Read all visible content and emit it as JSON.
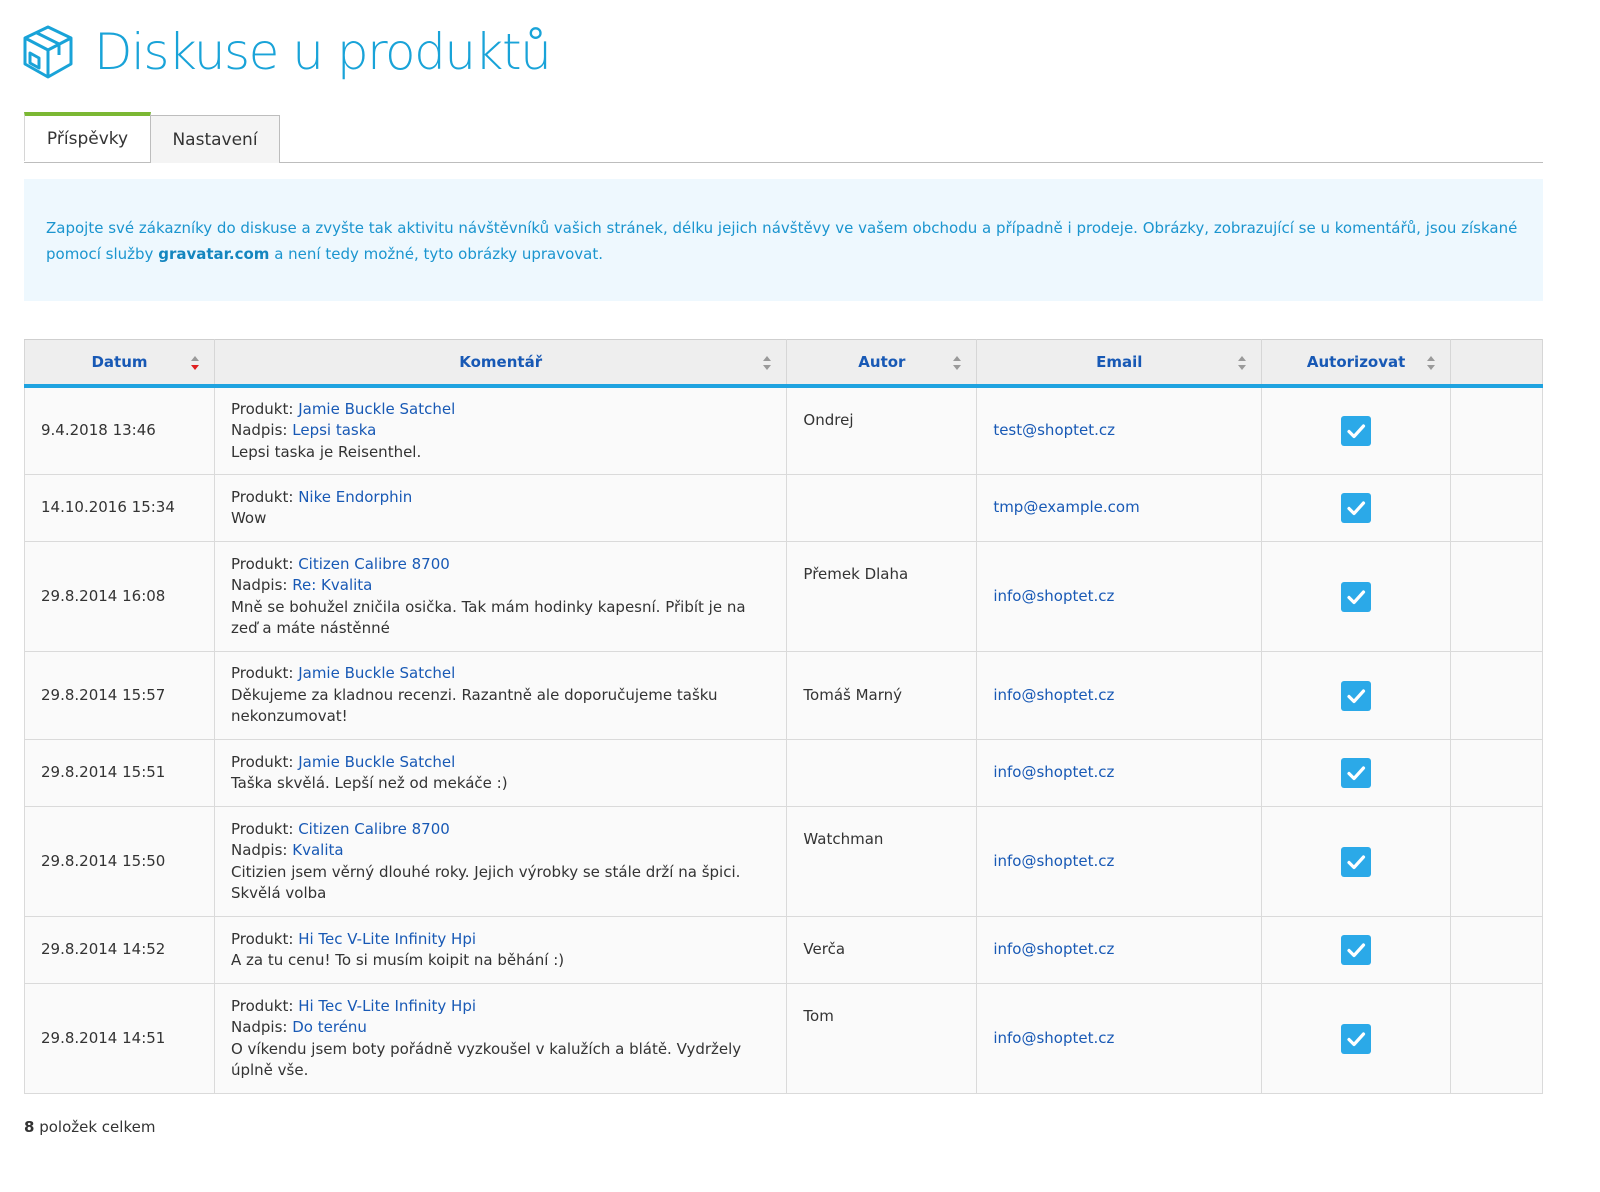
{
  "header": {
    "title": "Diskuse u produktů",
    "icon": "package-box-icon"
  },
  "tabs": [
    {
      "label": "Příspěvky",
      "active": true
    },
    {
      "label": "Nastavení",
      "active": false
    }
  ],
  "info": {
    "text_before": "Zapojte své zákazníky do diskuse a zvyšte tak aktivitu návštěvníků vašich stránek, délku jejich návštěvy ve vašem obchodu a případně i prodeje. Obrázky, zobrazující se u komentářů, jsou získané pomocí služby ",
    "link": "gravatar.com",
    "text_after": " a není tedy možné, tyto obrázky upravovat."
  },
  "table": {
    "columns": [
      "Datum",
      "Komentář",
      "Autor",
      "Email",
      "Autorizovat",
      ""
    ],
    "product_label": "Produkt:",
    "title_label": "Nadpis:",
    "rows": [
      {
        "date": "9.4.2018 13:46",
        "product": "Jamie Buckle Satchel",
        "title": "Lepsi taska",
        "text": "Lepsi taska je Reisenthel.",
        "author": "Ondrej",
        "email": "test@shoptet.cz",
        "authorized": true
      },
      {
        "date": "14.10.2016 15:34",
        "product": "Nike Endorphin",
        "title": "",
        "text": "Wow",
        "author": "",
        "email": "tmp@example.com",
        "authorized": true
      },
      {
        "date": "29.8.2014 16:08",
        "product": "Citizen Calibre 8700",
        "title": "Re: Kvalita",
        "text": "Mně se bohužel zničila osička. Tak mám hodinky kapesní. Přibít je na zeď a máte nástěnné",
        "author": "Přemek Dlaha",
        "email": "info@shoptet.cz",
        "authorized": true
      },
      {
        "date": "29.8.2014 15:57",
        "product": "Jamie Buckle Satchel",
        "title": "",
        "text": "Děkujeme za kladnou recenzi. Razantně ale doporučujeme tašku nekonzumovat!",
        "author": "Tomáš Marný",
        "email": "info@shoptet.cz",
        "authorized": true
      },
      {
        "date": "29.8.2014 15:51",
        "product": "Jamie Buckle Satchel",
        "title": "",
        "text": "Taška skvělá. Lepší než od mekáče :)",
        "author": "",
        "email": "info@shoptet.cz",
        "authorized": true
      },
      {
        "date": "29.8.2014 15:50",
        "product": "Citizen Calibre 8700",
        "title": "Kvalita",
        "text": "Citizien jsem věrný dlouhé roky. Jejich výrobky se stále drží na špici. Skvělá volba",
        "author": "Watchman",
        "email": "info@shoptet.cz",
        "authorized": true
      },
      {
        "date": "29.8.2014 14:52",
        "product": "Hi Tec V-Lite Infinity Hpi",
        "title": "",
        "text": "A za tu cenu! To si musím koipit na běhání :)",
        "author": "Verča",
        "email": "info@shoptet.cz",
        "authorized": true
      },
      {
        "date": "29.8.2014 14:51",
        "product": "Hi Tec V-Lite Infinity Hpi",
        "title": "Do terénu",
        "text": "O víkendu jsem boty pořádně vyzkoušel v kalužích a blátě. Vydržely úplně vše.",
        "author": "Tom",
        "email": "info@shoptet.cz",
        "authorized": true
      }
    ]
  },
  "footer": {
    "count": "8",
    "label": " položek celkem"
  },
  "colors": {
    "accent": "#19a3d8",
    "link": "#1859b5",
    "tab_active": "#7bb833",
    "checkbox": "#2ba9e8"
  }
}
